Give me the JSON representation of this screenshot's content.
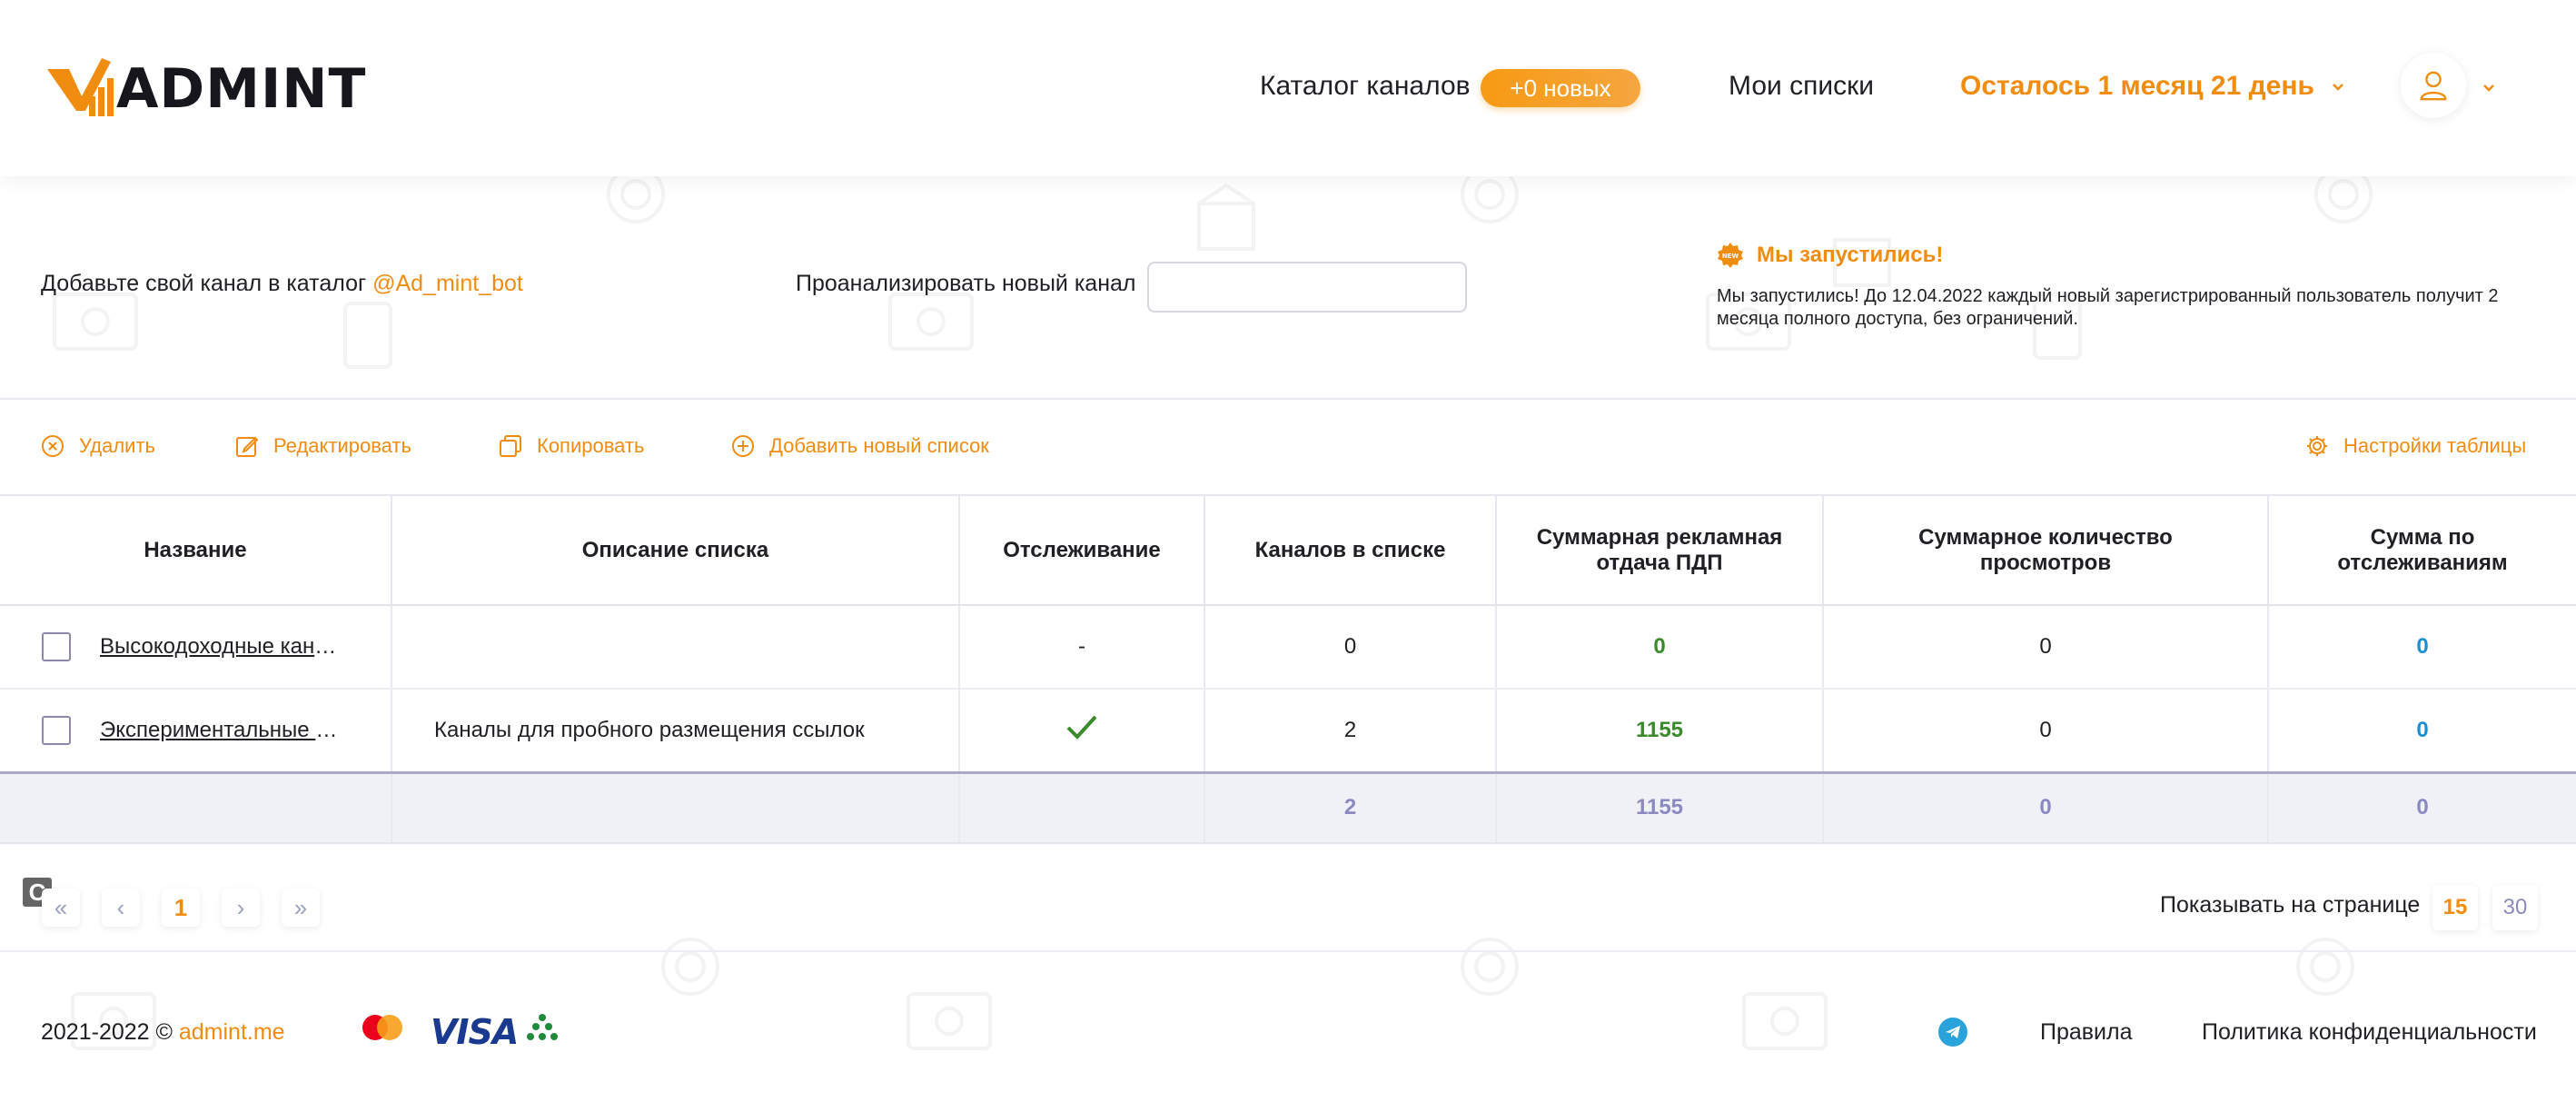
{
  "header": {
    "logo_text": "ADMINT",
    "nav_catalog": "Каталог каналов",
    "badge_new": "+0 новых",
    "nav_lists": "Мои списки",
    "subscription_left": "Осталось 1 месяц 21 день"
  },
  "info": {
    "add_channel_text": "Добавьте свой канал в каталог",
    "bot_handle": "@Ad_mint_bot",
    "analyze_label": "Проанализировать новый канал",
    "analyze_placeholder": "",
    "news_title": "Мы запустились!",
    "news_text": "Мы запустились! До 12.04.2022 каждый новый зарегистрированный пользователь получит 2 месяца полного доступа, без ограничений."
  },
  "toolbar": {
    "delete": "Удалить",
    "edit": "Редактировать",
    "copy": "Копировать",
    "add_list": "Добавить новый список",
    "table_settings": "Настройки таблицы"
  },
  "table": {
    "columns": [
      "Название",
      "Описание списка",
      "Отслеживание",
      "Каналов в списке",
      "Суммарная рекламная отдача ПДП",
      "Суммарное количество просмотров",
      "Сумма по отслеживаниям"
    ],
    "rows": [
      {
        "name": "Высокодоходные каналы",
        "description": "",
        "tracking": "-",
        "channels": "0",
        "ad_return": "0",
        "views": "0",
        "tracking_sum": "0"
      },
      {
        "name": "Экспериментальные каналы",
        "description": "Каналы для пробного размещения ссылок",
        "tracking": "check",
        "channels": "2",
        "ad_return": "1155",
        "views": "0",
        "tracking_sum": "0"
      }
    ],
    "totals": {
      "channels": "2",
      "ad_return": "1155",
      "views": "0",
      "tracking_sum": "0"
    }
  },
  "pager": {
    "first": "«",
    "prev": "‹",
    "current_page": "1",
    "next": "›",
    "last": "»",
    "per_page_label": "Показывать на странице",
    "per_page_options": [
      "15",
      "30"
    ],
    "per_page_selected": "15"
  },
  "footer": {
    "copyright": "2021-2022 ©",
    "site": "admint.me",
    "visa": "VISA",
    "rules": "Правила",
    "privacy": "Политика конфиденциальности"
  },
  "colors": {
    "accent": "#f08c10",
    "green": "#3a8a2c",
    "blue": "#1d8ed1",
    "totals_text": "#8a8ac0"
  },
  "icons": {
    "tracking_check": "check-icon",
    "delete": "close-circle-icon",
    "edit": "edit-icon",
    "copy": "copy-icon",
    "add": "plus-circle-icon",
    "settings": "gear-icon",
    "news": "new-badge-icon",
    "user": "user-icon",
    "telegram": "telegram-icon"
  }
}
